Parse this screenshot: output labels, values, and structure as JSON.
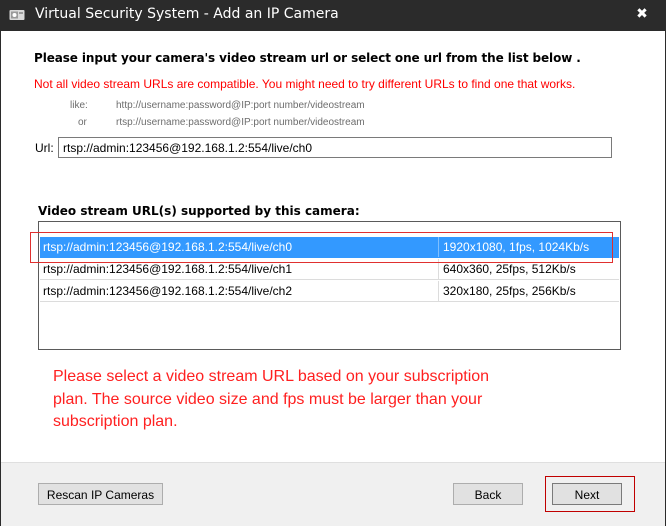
{
  "window": {
    "title": "Virtual Security System - Add an IP Camera",
    "close_glyph": "✖",
    "app_icon": "shield-camera-icon"
  },
  "instructions": {
    "heading": "Please input your camera's video stream url or select one url from the list below .",
    "warning": "Not all video stream URLs are compatible. You might need to try different URLs to find one that works.",
    "like_label": "like:",
    "like_example": "http://username:password@IP:port number/videostream",
    "or_label": "or",
    "or_example": "rtsp://username:password@IP:port number/videostream"
  },
  "url_field": {
    "label": "Url:",
    "value": "rtsp://admin:123456@192.168.1.2:554/live/ch0"
  },
  "stream_list": {
    "label": "Video stream URL(s) supported by this camera:",
    "rows": [
      {
        "url": "rtsp://admin:123456@192.168.1.2:554/live/ch0",
        "info": "1920x1080, 1fps, 1024Kb/s",
        "selected": true
      },
      {
        "url": "rtsp://admin:123456@192.168.1.2:554/live/ch1",
        "info": "640x360, 25fps, 512Kb/s",
        "selected": false
      },
      {
        "url": "rtsp://admin:123456@192.168.1.2:554/live/ch2",
        "info": "320x180, 25fps, 256Kb/s",
        "selected": false
      }
    ]
  },
  "note": {
    "line1": "Please select a video stream URL based on your subscription",
    "line2": "plan. The source video size and fps must be larger than your",
    "line3": "subscription plan."
  },
  "buttons": {
    "rescan": "Rescan IP Cameras",
    "back": "Back",
    "next": "Next"
  },
  "colors": {
    "selection": "#3399ff",
    "warning": "#ff0000",
    "titlebar": "#2b2b2b"
  }
}
